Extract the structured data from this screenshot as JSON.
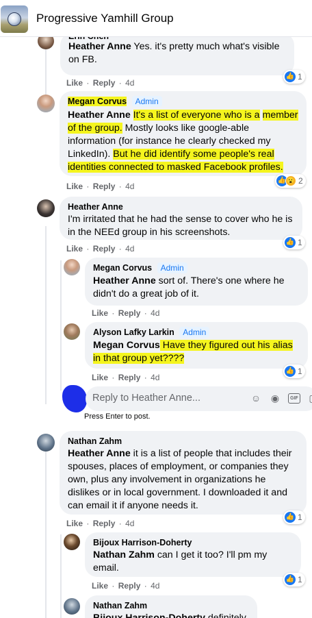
{
  "header": {
    "group_name": "Progressive Yamhill Group"
  },
  "colors": {
    "like_blue": "#1877f2",
    "highlight": "#f5f51e",
    "bubble": "#f0f2f5",
    "link_blue": "#1877f2"
  },
  "actions": {
    "like": "Like",
    "reply": "Reply",
    "sep": "·"
  },
  "comments": [
    {
      "author": "Erin Chen",
      "mention": "Heather Anne",
      "text": " Yes. it's pretty much what's visible on FB.",
      "time": "4d",
      "reactions": "1"
    },
    {
      "author": "Megan Corvus",
      "badge": "Admin",
      "mention": "Heather Anne",
      "text_a": "It's a list of everyone who is a",
      "text_b": "member of the group.",
      "text_c": " Mostly looks like google-able information (for instance he clearly checked my LinkedIn). ",
      "text_d": "But he did identify some people's real identities connected to masked Facebook profiles.",
      "time": "4d",
      "reactions": "2"
    },
    {
      "author": "Heather Anne",
      "text": "I'm irritated that he had the sense to cover who he is in the NEEd group in his screenshots.",
      "time": "4d",
      "reactions": "1"
    },
    {
      "author": "Megan Corvus",
      "badge": "Admin",
      "mention": "Heather Anne",
      "text": " sort of. There's one where he didn't do a great job of it.",
      "time": "4d"
    },
    {
      "author": "Alyson Lafky Larkin",
      "badge": "Admin",
      "mention": "Megan Corvus",
      "text": " Have they figured out his alias in that group yet????",
      "time": "4d",
      "reactions": "1"
    },
    {
      "author": "Nathan Zahm",
      "mention": "Heather Anne",
      "text": " it is a list of people that includes their spouses, places of employment, or companies they own, plus any involvement in organizations he dislikes or in local government. I downloaded it and can email it if anyone needs it.",
      "time": "4d",
      "reactions": "1"
    },
    {
      "author": "Bijoux Harrison-Doherty",
      "mention": "Nathan Zahm",
      "text": " can I get it too? I'll pm my email.",
      "time": "4d",
      "reactions": "1"
    },
    {
      "author": "Nathan Zahm",
      "mention": "Bijoux Harrison-Doherty",
      "text": " definitely"
    }
  ],
  "reply_box": {
    "placeholder": "Reply to Heather Anne...",
    "hint": "Press Enter to post."
  },
  "icons": [
    "group-logo-icon",
    "like-icon",
    "wow-icon",
    "emoji-icon",
    "camera-icon",
    "gif-icon",
    "sticker-icon"
  ]
}
